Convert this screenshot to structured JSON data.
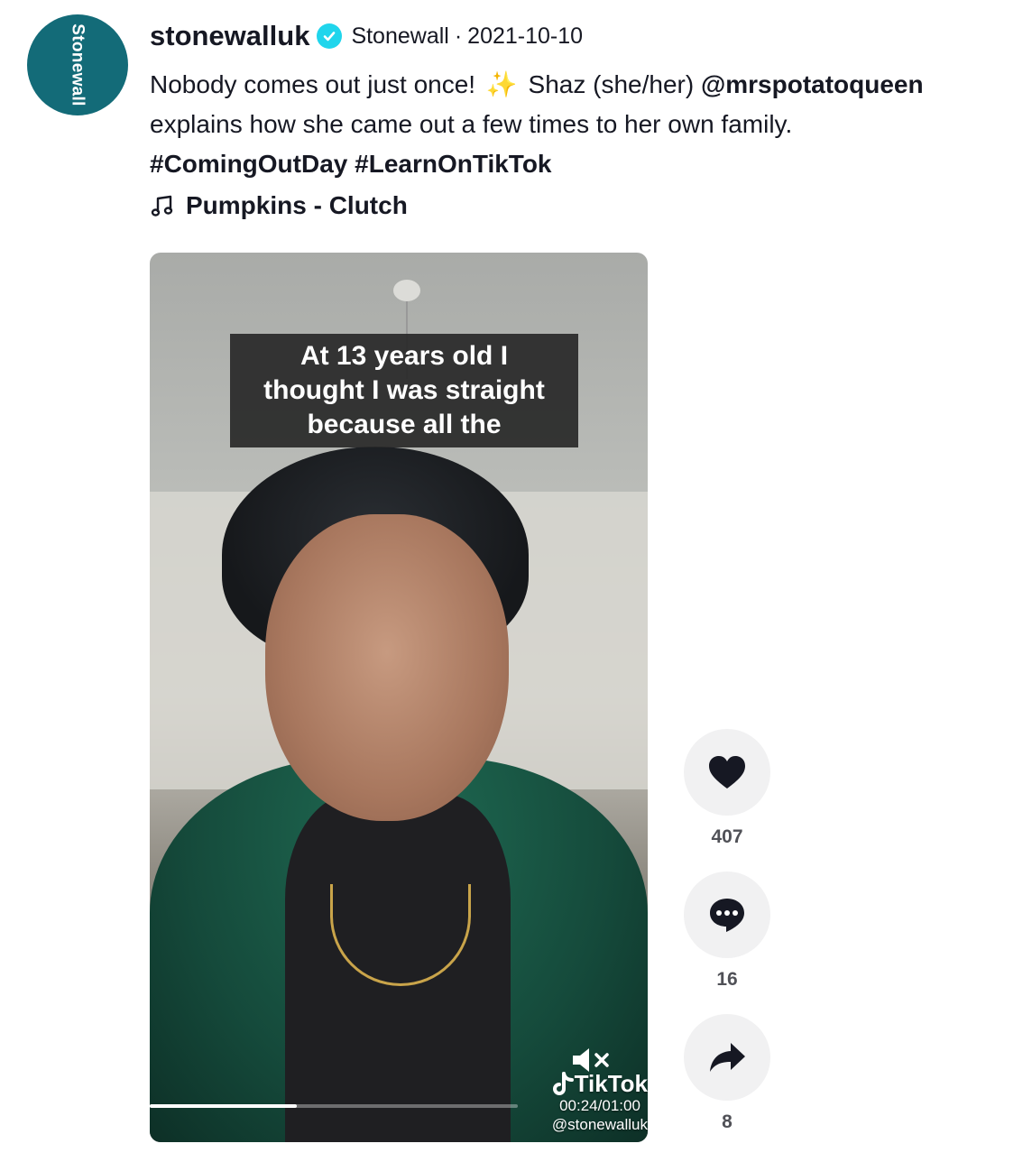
{
  "avatar": {
    "text": "Stonewall",
    "color": "#136b78"
  },
  "header": {
    "username": "stonewalluk",
    "verified_icon": "verified-check-icon",
    "display_name": "Stonewall",
    "separator": "·",
    "date": "2021-10-10"
  },
  "caption": {
    "text_start": "Nobody comes out just once!",
    "sparkle": "✨",
    "text_middle": "Shaz (she/her)",
    "mention": "@mrspotatoqueen",
    "text_end": "explains how she came out a few times to her own family.",
    "hashtags": [
      "#ComingOutDay",
      "#LearnOnTikTok"
    ]
  },
  "music": {
    "icon": "music-note-icon",
    "label": "Pumpkins - Clutch"
  },
  "video": {
    "overlay_text": [
      "At 13 years old I",
      "thought I was straight",
      "because all the"
    ],
    "mute_icon": "muted-speaker-icon",
    "brand": "TikTok",
    "handle": "@stonewalluk",
    "timecode": "00:24/01:00",
    "progress": 0.4
  },
  "actions": {
    "likes": {
      "icon": "heart-icon",
      "count": "407"
    },
    "comments": {
      "icon": "comment-icon",
      "count": "16"
    },
    "shares": {
      "icon": "share-arrow-icon",
      "count": "8"
    }
  }
}
